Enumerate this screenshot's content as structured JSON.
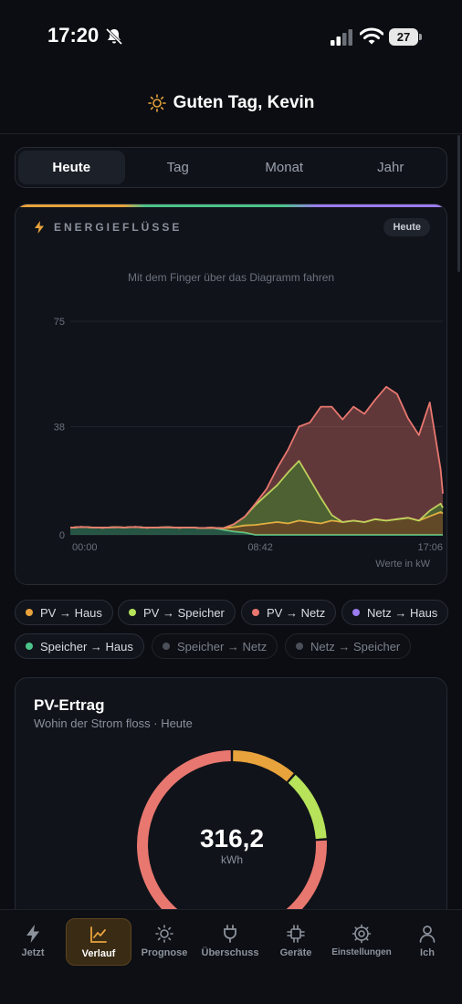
{
  "status": {
    "time": "17:20",
    "battery": "27"
  },
  "greeting": "Guten Tag, Kevin",
  "segments": [
    {
      "label": "Heute",
      "active": true
    },
    {
      "label": "Tag",
      "active": false
    },
    {
      "label": "Monat",
      "active": false
    },
    {
      "label": "Jahr",
      "active": false
    }
  ],
  "flow_card": {
    "title": "ENERGIEFLÜSSE",
    "badge": "Heute",
    "hint": "Mit dem Finger über das Diagramm fahren",
    "unit_note": "Werte in kW"
  },
  "legend": [
    {
      "label": "PV → Haus",
      "color": "#e8a33c",
      "active": true
    },
    {
      "label": "PV → Speicher",
      "color": "#b6e35a",
      "active": true
    },
    {
      "label": "PV → Netz",
      "color": "#e8776f",
      "active": true
    },
    {
      "label": "Netz → Haus",
      "color": "#9b7cf0",
      "active": true
    },
    {
      "label": "Speicher → Haus",
      "color": "#4cc38a",
      "active": true
    },
    {
      "label": "Speicher → Netz",
      "color": "#4a4f59",
      "active": false
    },
    {
      "label": "Netz → Speicher",
      "color": "#4a4f59",
      "active": false
    }
  ],
  "pv_card": {
    "title": "PV-Ertrag",
    "subtitle": "Wohin der Strom floss · Heute",
    "value": "316,2",
    "unit": "kWh",
    "segments": [
      {
        "name": "PV → Haus",
        "fraction": 0.115,
        "color": "#e8a33c"
      },
      {
        "name": "PV → Speicher",
        "fraction": 0.125,
        "color": "#b6e35a"
      },
      {
        "name": "PV → Netz",
        "fraction": 0.76,
        "color": "#e8776f"
      }
    ]
  },
  "tabs": [
    {
      "label": "Jetzt",
      "icon": "bolt-icon",
      "active": false
    },
    {
      "label": "Verlauf",
      "icon": "line-chart-icon",
      "active": true
    },
    {
      "label": "Prognose",
      "icon": "sun-icon",
      "active": false
    },
    {
      "label": "Überschuss",
      "icon": "plug-icon",
      "active": false
    },
    {
      "label": "Geräte",
      "icon": "chip-icon",
      "active": false
    },
    {
      "label": "Einstellungen",
      "icon": "gear-icon",
      "active": false
    },
    {
      "label": "Ich",
      "icon": "person-icon",
      "active": false
    }
  ],
  "chart_data": {
    "type": "area",
    "title": "ENERGIEFLÜSSE",
    "ylim": [
      0,
      75
    ],
    "y_ticks": [
      0,
      38,
      75
    ],
    "x_tick_labels": [
      "00:00",
      "08:42",
      "17:06"
    ],
    "x_hours": [
      0,
      0.5,
      1,
      1.5,
      2,
      2.5,
      3,
      3.5,
      4,
      4.5,
      5,
      5.5,
      6,
      6.5,
      7,
      7.5,
      8,
      8.5,
      9,
      9.5,
      10,
      10.5,
      11,
      11.5,
      12,
      12.5,
      13,
      13.5,
      14,
      14.5,
      15,
      15.5,
      16,
      16.5,
      17,
      17.1
    ],
    "series": [
      {
        "name": "Speicher → Haus",
        "color": "#4cc38a",
        "values": [
          2.5,
          2.8,
          2.6,
          2.5,
          2.7,
          2.6,
          2.8,
          2.5,
          2.6,
          2.7,
          2.5,
          2.6,
          2.4,
          2.5,
          1.8,
          1.2,
          0.8,
          0,
          0,
          0,
          0,
          0,
          0,
          0,
          0,
          0,
          0,
          0,
          0,
          0,
          0,
          0,
          0,
          0,
          0,
          0
        ]
      },
      {
        "name": "PV → Haus",
        "color": "#e8a33c",
        "values": [
          0,
          0,
          0,
          0,
          0,
          0,
          0,
          0,
          0,
          0,
          0,
          0,
          0,
          0,
          0.5,
          1.5,
          2.5,
          3.5,
          4,
          4.5,
          4,
          5,
          4.5,
          4,
          5,
          4.5,
          5,
          4.5,
          5.5,
          5,
          5.5,
          6,
          5,
          6.5,
          8,
          7.5
        ]
      },
      {
        "name": "PV → Speicher",
        "color": "#b6e35a",
        "values": [
          0,
          0,
          0,
          0,
          0,
          0,
          0,
          0,
          0,
          0,
          0,
          0,
          0,
          0,
          0,
          1,
          3,
          7,
          10,
          13,
          18,
          21,
          15,
          9,
          2,
          0,
          0,
          0,
          0,
          0,
          0,
          0,
          0,
          2,
          3,
          2
        ]
      },
      {
        "name": "PV → Netz",
        "color": "#e8776f",
        "values": [
          0,
          0,
          0,
          0,
          0,
          0,
          0,
          0,
          0,
          0,
          0,
          0,
          0,
          0,
          0,
          0,
          0,
          0.5,
          2,
          6,
          8,
          12,
          20,
          32,
          38,
          36,
          40,
          38,
          42,
          47,
          44,
          35,
          30,
          38,
          12,
          5
        ]
      }
    ]
  }
}
